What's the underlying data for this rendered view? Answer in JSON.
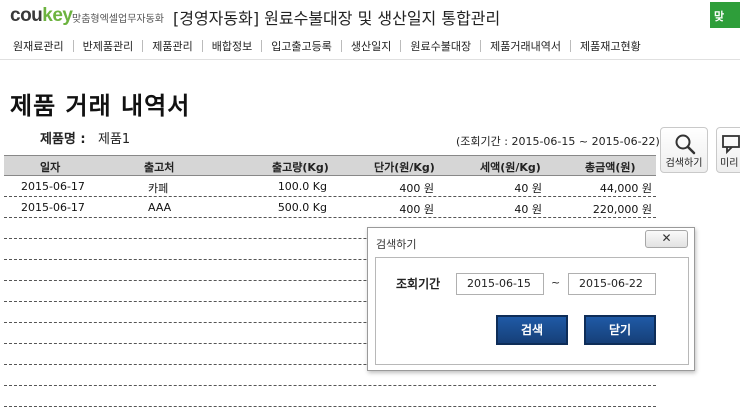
{
  "header": {
    "logo_part1": "cou",
    "logo_part2": "key",
    "logo_sub": "맞춤형엑셀업무자동화",
    "app_title": "[경영자동화] 원료수불대장 및 생산일지 통합관리",
    "right_button": "맞"
  },
  "menu": [
    {
      "label": "원재료관리"
    },
    {
      "label": "반제품관리"
    },
    {
      "label": "제품관리"
    },
    {
      "label": "배합정보"
    },
    {
      "label": "입고출고등록"
    },
    {
      "label": "생산일지"
    },
    {
      "label": "원료수불대장"
    },
    {
      "label": "제품거래내역서"
    },
    {
      "label": "제품재고현황"
    }
  ],
  "page": {
    "title": "제품 거래 내역서",
    "product_label": "제품명 :",
    "product_value": "제품1",
    "period": "(조회기간 : 2015-06-15 ~ 2015-06-22)"
  },
  "side_buttons": {
    "search_label": "검색하기",
    "preview_label": "미리"
  },
  "table": {
    "columns": [
      "일자",
      "출고처",
      "출고량(Kg)",
      "단가(원/Kg)",
      "세액(원/Kg)",
      "총금액(원)"
    ],
    "rows": [
      [
        "2015-06-17",
        "카페",
        "100.0 Kg",
        "400 원",
        "40 원",
        "44,000 원"
      ],
      [
        "2015-06-17",
        "AAA",
        "500.0 Kg",
        "400 원",
        "40 원",
        "220,000 원"
      ]
    ]
  },
  "dialog": {
    "title": "검색하기",
    "close_symbol": "✕",
    "period_label": "조회기간",
    "date_from": "2015-06-15",
    "tilde": "~",
    "date_to": "2015-06-22",
    "search_button": "검색",
    "close_button": "닫기"
  },
  "colors": {
    "logo_green": "#6cb33f",
    "header_green_button": "#2e9e3a",
    "dialog_button_blue": "#1f5aa6",
    "table_header_bg": "#d6d6d6"
  }
}
